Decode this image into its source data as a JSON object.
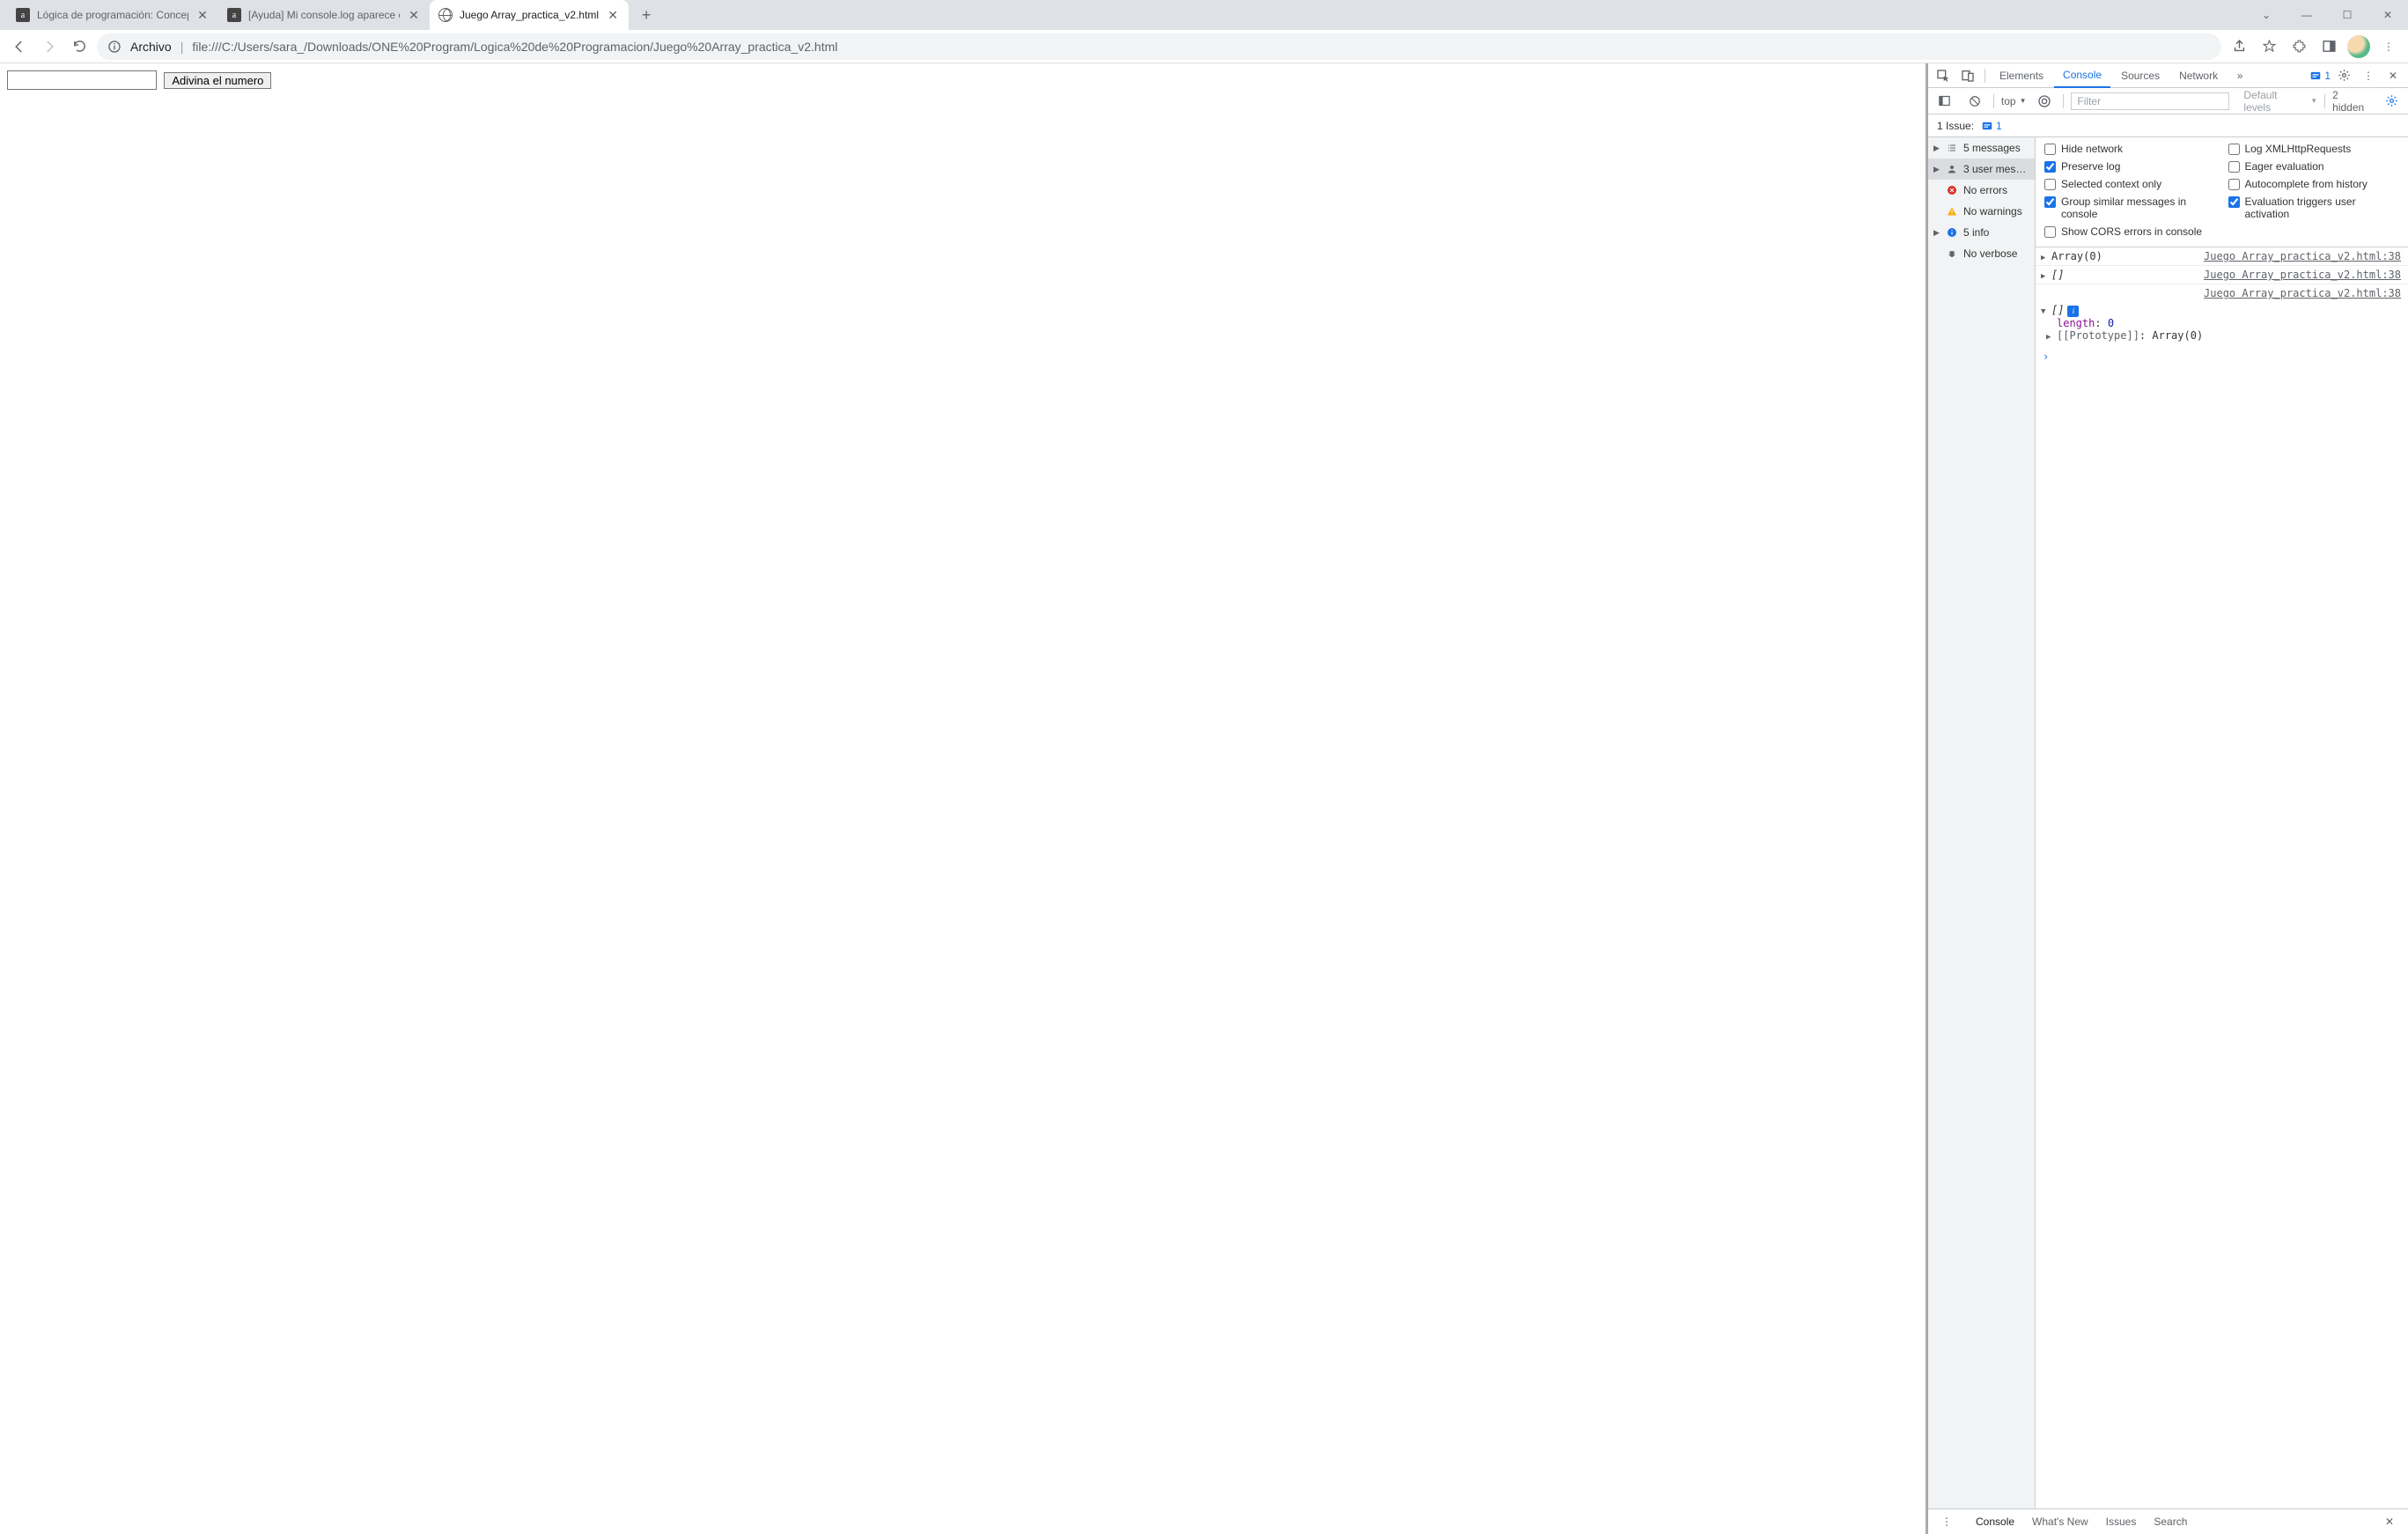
{
  "window": {
    "minimize": "—",
    "maximize": "☐",
    "close": "✕",
    "dropdown": "⌄"
  },
  "tabs": [
    {
      "title": "Lógica de programación: Concep",
      "active": false,
      "favicon": "a"
    },
    {
      "title": "[Ayuda] Mi console.log aparece c",
      "active": false,
      "favicon": "a"
    },
    {
      "title": "Juego Array_practica_v2.html",
      "active": true,
      "favicon": "globe"
    }
  ],
  "toolbar": {
    "origin_label": "Archivo",
    "url": "file:///C:/Users/sara_/Downloads/ONE%20Program/Logica%20de%20Programacion/Juego%20Array_practica_v2.html"
  },
  "page": {
    "button_label": "Adivina el numero"
  },
  "devtools": {
    "tabs": {
      "elements": "Elements",
      "console": "Console",
      "sources": "Sources",
      "network": "Network"
    },
    "issues_badge": "1",
    "subbar": {
      "context": "top",
      "filter_placeholder": "Filter",
      "levels": "Default levels",
      "hidden": "2 hidden"
    },
    "issuebar": {
      "label": "1 Issue:",
      "count": "1"
    },
    "sidebar": {
      "messages": "5 messages",
      "user": "3 user mess...",
      "errors": "No errors",
      "warnings": "No warnings",
      "info": "5 info",
      "verbose": "No verbose"
    },
    "settings": {
      "hide_network": "Hide network",
      "log_xhr": "Log XMLHttpRequests",
      "preserve_log": "Preserve log",
      "eager_eval": "Eager evaluation",
      "selected_ctx": "Selected context only",
      "autocomplete": "Autocomplete from history",
      "group_similar": "Group similar messages in console",
      "eval_triggers": "Evaluation triggers user activation",
      "show_cors": "Show CORS errors in console"
    },
    "logs": {
      "row1_obj": "Array(0)",
      "row2_obj": "[]",
      "row3_obj": "[]",
      "expanded_length_key": "length",
      "expanded_length_val": "0",
      "proto_label": "[[Prototype]]",
      "proto_val": "Array(0)",
      "src": "Juego Array_practica_v2.html:38"
    },
    "drawer": {
      "console": "Console",
      "whatsnew": "What's New",
      "issues": "Issues",
      "search": "Search"
    }
  }
}
